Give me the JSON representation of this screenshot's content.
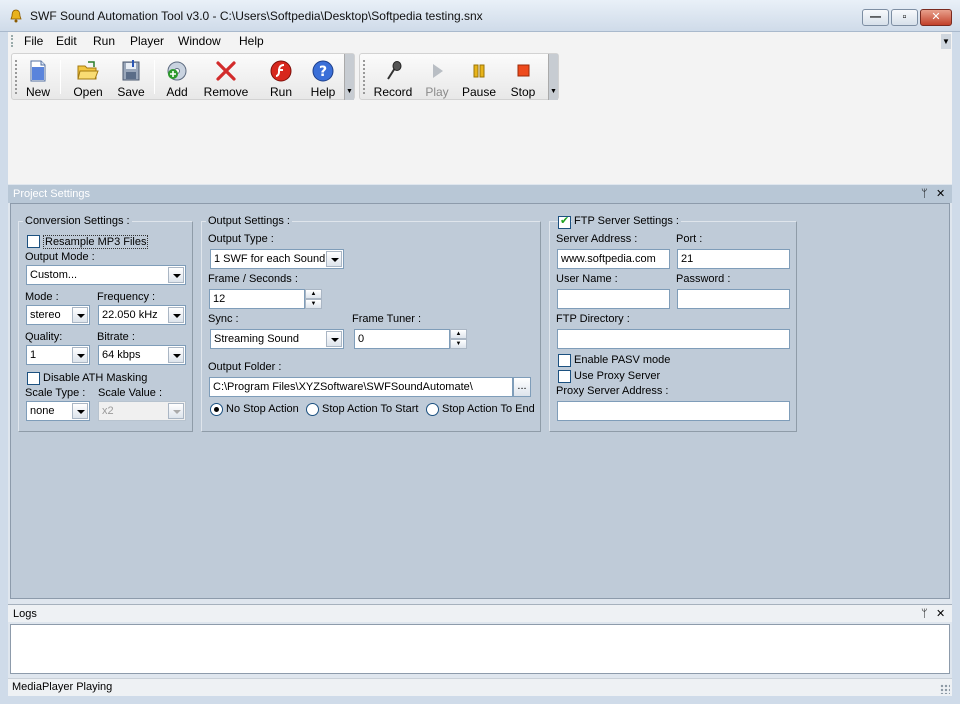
{
  "window": {
    "title": "SWF Sound Automation Tool v3.0 - C:\\Users\\Softpedia\\Desktop\\Softpedia testing.snx",
    "min_label": "—",
    "max_label": "▫",
    "close_label": "✕"
  },
  "menu": {
    "file": "File",
    "edit": "Edit",
    "run": "Run",
    "player": "Player",
    "window": "Window",
    "help": "Help",
    "overflow": "▼"
  },
  "toolbar": {
    "new": "New",
    "open": "Open",
    "save": "Save",
    "add": "Add",
    "remove": "Remove",
    "run": "Run",
    "help": "Help",
    "record": "Record",
    "play": "Play",
    "pause": "Pause",
    "stop": "Stop",
    "chevron": "▼"
  },
  "project_settings": {
    "header": "Project Settings",
    "pin": "ᛘ",
    "close": "✕",
    "conversion": {
      "title": "Conversion Settings :",
      "resample_label": "Resample MP3 Files",
      "output_mode_label": "Output Mode :",
      "output_mode_value": "Custom...",
      "mode_label": "Mode :",
      "mode_value": "stereo",
      "frequency_label": "Frequency :",
      "frequency_value": "22.050 kHz",
      "quality_label": "Quality:",
      "quality_value": "1",
      "bitrate_label": "Bitrate :",
      "bitrate_value": "64 kbps",
      "ath_label": "Disable ATH Masking",
      "scale_type_label": "Scale Type :",
      "scale_type_value": "none",
      "scale_value_label": "Scale Value :",
      "scale_value_value": "x2"
    },
    "output": {
      "title": "Output Settings :",
      "output_type_label": "Output Type :",
      "output_type_value": "1 SWF for each Sound",
      "frame_label": "Frame / Seconds :",
      "frame_value": "12",
      "sync_label": "Sync :",
      "sync_value": "Streaming Sound",
      "tuner_label": "Frame Tuner :",
      "tuner_value": "0",
      "folder_label": "Output Folder :",
      "folder_value": "C:\\Program Files\\XYZSoftware\\SWFSoundAutomate\\",
      "browse": "...",
      "radio_no_stop": "No Stop Action",
      "radio_to_start": "Stop Action To Start",
      "radio_to_end": "Stop Action To End"
    },
    "ftp": {
      "title": "FTP Server Settings :",
      "server_label": "Server Address :",
      "server_value": "www.softpedia.com",
      "port_label": "Port :",
      "port_value": "21",
      "user_label": "User Name :",
      "user_value": "",
      "password_label": "Password :",
      "password_value": "",
      "dir_label": "FTP Directory :",
      "dir_value": "",
      "pasv_label": "Enable PASV mode",
      "proxy_label": "Use Proxy Server",
      "proxy_addr_label": "Proxy Server Address :",
      "proxy_addr_value": ""
    }
  },
  "logs": {
    "header": "Logs",
    "pin": "ᛘ",
    "close": "✕"
  },
  "status": {
    "text": "MediaPlayer Playing"
  }
}
